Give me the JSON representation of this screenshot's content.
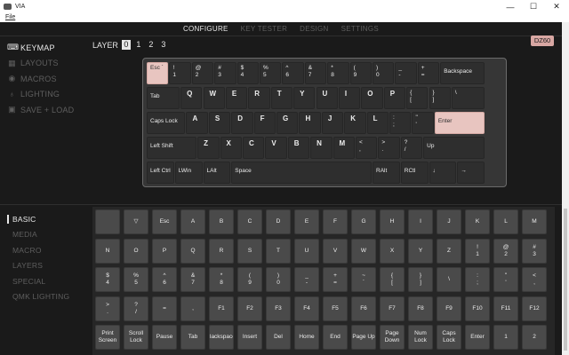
{
  "window": {
    "title": "VIA",
    "minimize": "—",
    "maximize": "☐",
    "close": "✕"
  },
  "menu": {
    "file": "File"
  },
  "nav": [
    "CONFIGURE",
    "KEY TESTER",
    "DESIGN",
    "SETTINGS"
  ],
  "sidebar_top": [
    {
      "label": "KEYMAP",
      "icon": "keyboard-icon",
      "glyph": "⌨",
      "active": true
    },
    {
      "label": "LAYOUTS",
      "icon": "grid-icon",
      "glyph": "▦",
      "active": false
    },
    {
      "label": "MACROS",
      "icon": "circle-dot-icon",
      "glyph": "◉",
      "active": false
    },
    {
      "label": "LIGHTING",
      "icon": "bulb-icon",
      "glyph": "♁",
      "active": false
    },
    {
      "label": "SAVE + LOAD",
      "icon": "floppy-icon",
      "glyph": "▣",
      "active": false
    }
  ],
  "sidebar_bottom": [
    "BASIC",
    "MEDIA",
    "MACRO",
    "LAYERS",
    "SPECIAL",
    "QMK LIGHTING"
  ],
  "layer": {
    "label": "LAYER",
    "layers": [
      "0",
      "1",
      "2",
      "3"
    ],
    "active": 0
  },
  "badge": "DZ60",
  "keyboard_rows": [
    [
      "Esc `|",
      "!|1",
      "@|2",
      "#|3",
      "$|4",
      "%|5",
      "^|6",
      "&|7",
      "*|8",
      "(|9",
      ")|0",
      "_|-",
      "+|=",
      "Backspace"
    ],
    [
      "Tab",
      "Q",
      "W",
      "E",
      "R",
      "T",
      "Y",
      "U",
      "I",
      "O",
      "P",
      "{|[",
      "}|]",
      "|\\"
    ],
    [
      "Caps Lock",
      "A",
      "S",
      "D",
      "F",
      "G",
      "H",
      "J",
      "K",
      "L",
      ":|;",
      "\"|'",
      "Enter"
    ],
    [
      "Left Shift",
      "Z",
      "X",
      "C",
      "V",
      "B",
      "N",
      "M",
      "<|,",
      ">|.",
      "?|/",
      "Up"
    ],
    [
      "Left Ctrl",
      "LWin",
      "LAlt",
      "Space",
      "RAlt",
      "RCtl",
      "↓",
      "→"
    ]
  ],
  "picker_rows": [
    [
      "",
      "▽",
      "Esc",
      "A",
      "B",
      "C",
      "D",
      "E",
      "F",
      "G",
      "H",
      "I",
      "J",
      "K",
      "L",
      "M"
    ],
    [
      "N",
      "O",
      "P",
      "Q",
      "R",
      "S",
      "T",
      "U",
      "V",
      "W",
      "X",
      "Y",
      "Z",
      "!|1",
      "@|2",
      "#|3"
    ],
    [
      "$|4",
      "%|5",
      "^|6",
      "&|7",
      "*|8",
      "(|9",
      ")|0",
      "_|-",
      "+|=",
      "~|`",
      "{|[",
      "}|]",
      "||\\",
      ":|;",
      "\"|'",
      "<|,"
    ],
    [
      ">|.",
      "?|/",
      "=",
      ",",
      "F1",
      "F2",
      "F3",
      "F4",
      "F5",
      "F6",
      "F7",
      "F8",
      "F9",
      "F10",
      "F11",
      "F12"
    ],
    [
      "Print|Screen",
      "Scroll|Lock",
      "Pause",
      "Tab",
      "Backspace",
      "Insert",
      "Del",
      "Home",
      "End",
      "Page Up",
      "Page|Down",
      "Num|Lock",
      "Caps|Lock",
      "Enter",
      "1",
      "2"
    ]
  ],
  "colors": {
    "highlight": "#e8c5c0",
    "badge": "#d8a7a3",
    "background": "#1a1a1a"
  }
}
